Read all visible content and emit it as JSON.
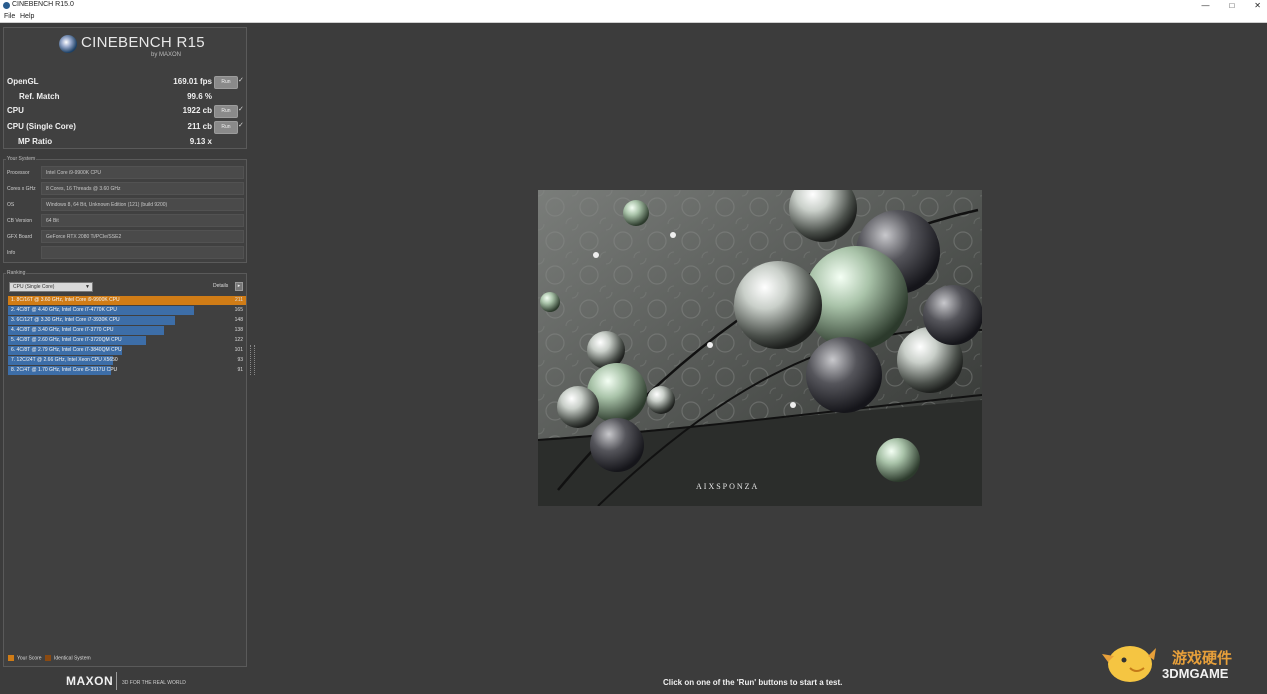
{
  "window": {
    "title": "CINEBENCH R15.0",
    "controls": [
      "—",
      "□",
      "✕"
    ]
  },
  "menu": [
    "File",
    "Help"
  ],
  "logo": {
    "title": "CINEBENCH R15",
    "by": "by MAXON"
  },
  "scores": [
    {
      "label": "OpenGL",
      "value": "169.01 fps",
      "has_run": true,
      "run_label": "Run"
    },
    {
      "label": "Ref. Match",
      "value": "99.6 %",
      "has_run": false
    },
    {
      "label": "CPU",
      "value": "1922 cb",
      "has_run": true,
      "run_label": "Run"
    },
    {
      "label": "CPU (Single Core)",
      "value": "211 cb",
      "has_run": true,
      "run_label": "Run"
    },
    {
      "label": "MP Ratio",
      "value": "9.13 x",
      "has_run": false
    }
  ],
  "your_system": {
    "section_label": "Your System",
    "rows": [
      {
        "key": "Processor",
        "value": "Intel Core i9-9900K CPU"
      },
      {
        "key": "Cores x GHz",
        "value": "8 Cores, 16 Threads @ 3.60 GHz"
      },
      {
        "key": "OS",
        "value": "Windows 8, 64 Bit, Unknown Edition (121) (build 9200)"
      },
      {
        "key": "CB Version",
        "value": "64 Bit"
      },
      {
        "key": "GFX Board",
        "value": "GeForce RTX 2080 Ti/PCIe/SSE2"
      },
      {
        "key": "Info",
        "value": ""
      }
    ]
  },
  "ranking": {
    "section_label": "Ranking",
    "dropdown": "CPU (Single Core)",
    "details_label": "Details",
    "max_score": 211,
    "rows": [
      {
        "label": "1. 8C/16T @ 3.60 GHz, Intel Core i9-9900K CPU",
        "score": 211,
        "highlight": true
      },
      {
        "label": "2. 4C/8T @ 4.40 GHz, Intel Core i7-4770K CPU",
        "score": 165,
        "highlight": false
      },
      {
        "label": "3. 6C/12T @ 3.30 GHz, Intel Core i7-3930K CPU",
        "score": 148,
        "highlight": false
      },
      {
        "label": "4. 4C/8T @ 3.40 GHz, Intel Core i7-3770 CPU",
        "score": 138,
        "highlight": false
      },
      {
        "label": "5. 4C/8T @ 2.60 GHz, Intel Core i7-3720QM CPU",
        "score": 122,
        "highlight": false
      },
      {
        "label": "6. 4C/8T @ 2.79 GHz, Intel Core i7-3840QM CPU",
        "score": 101,
        "highlight": false
      },
      {
        "label": "7. 12C/24T @ 2.66 GHz, Intel Xeon CPU X5650",
        "score": 93,
        "highlight": false
      },
      {
        "label": "8. 2C/4T @ 1.70 GHz, Intel Core i5-3317U CPU",
        "score": 91,
        "highlight": false
      }
    ],
    "legend": {
      "your_score": "Your Score",
      "identical": "Identical System",
      "your_color": "#d07c16",
      "identical_color": "#8a4a12"
    }
  },
  "footer": {
    "brand": "MAXON",
    "tagline": "3D FOR THE REAL WORLD"
  },
  "render": {
    "watermark": "AIXSPONZA"
  },
  "status": "Click on one of the 'Run' buttons to start a test.",
  "site_watermark": {
    "line1": "游戏硬件",
    "line2": "3DMGAME"
  },
  "colors": {
    "bar": "#3d6ea8",
    "highlight_bar": "#d07c16",
    "background": "#3c3c3c"
  }
}
